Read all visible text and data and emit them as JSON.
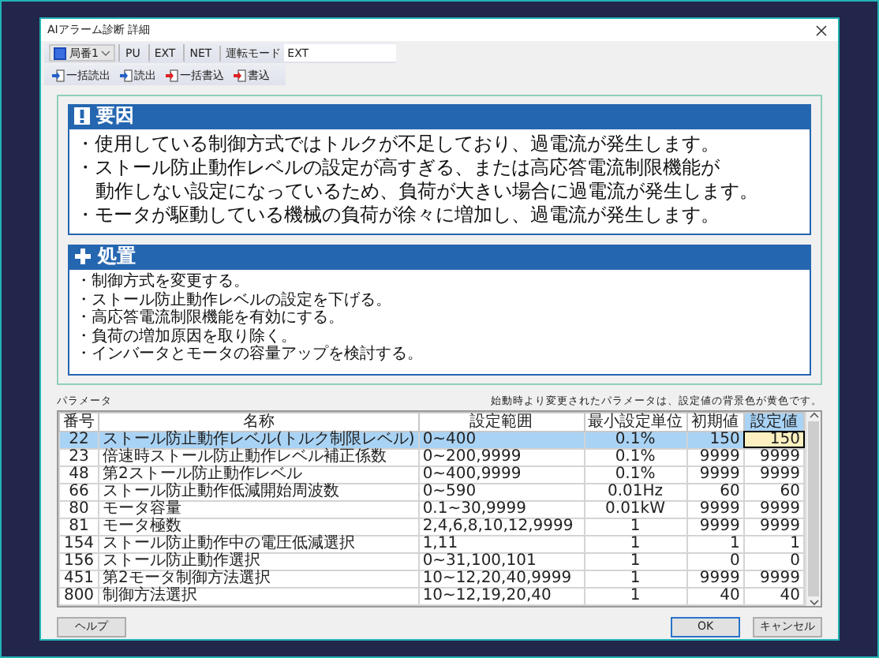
{
  "window": {
    "title": "AIアラーム診断 詳細"
  },
  "toolbar": {
    "station": "局番1",
    "modes": [
      "PU",
      "EXT",
      "NET"
    ],
    "mode_label": "運転モード",
    "mode_value": "EXT"
  },
  "actions": [
    {
      "label": "一括読出",
      "kind": "read"
    },
    {
      "label": "読出",
      "kind": "read"
    },
    {
      "label": "一括書込",
      "kind": "write"
    },
    {
      "label": "書込",
      "kind": "write"
    }
  ],
  "cause": {
    "title": "要因",
    "items": [
      {
        "text": "・使用している制御方式ではトルクが不足しており、過電流が発生します。",
        "kind": "bullet"
      },
      {
        "text": "・ストール防止動作レベルの設定が高すぎる、または高応答電流制限機能が",
        "kind": "bullet"
      },
      {
        "text": "動作しない設定になっているため、負荷が大きい場合に過電流が発生します。",
        "kind": "continuation"
      },
      {
        "text": "・モータが駆動している機械の負荷が徐々に増加し、過電流が発生します。",
        "kind": "bullet"
      }
    ]
  },
  "remedy": {
    "title": "処置",
    "items": [
      "・制御方式を変更する。",
      "・ストール防止動作レベルの設定を下げる。",
      "・高応答電流制限機能を有効にする。",
      "・負荷の増加原因を取り除く。",
      "・インバータとモータの容量アップを検討する。"
    ]
  },
  "parameters": {
    "label": "パラメータ",
    "notice": "始動時より変更されたパラメータは、設定値の背景色が黄色です。",
    "columns": [
      {
        "label": "番号",
        "selected": false
      },
      {
        "label": "名称",
        "selected": false
      },
      {
        "label": "設定範囲",
        "selected": false
      },
      {
        "label": "最小設定単位",
        "selected": false
      },
      {
        "label": "初期値",
        "selected": false
      },
      {
        "label": "設定値",
        "selected": true
      }
    ],
    "rows": [
      {
        "cells": [
          "22",
          "ストール防止動作レベル(トルク制限レベル)",
          "0~400",
          "0.1%",
          "150",
          "150"
        ],
        "selected": true
      },
      {
        "cells": [
          "23",
          "倍速時ストール防止動作レベル補正係数",
          "0~200,9999",
          "0.1%",
          "9999",
          "9999"
        ],
        "selected": false
      },
      {
        "cells": [
          "48",
          "第2ストール防止動作レベル",
          "0~400,9999",
          "0.1%",
          "9999",
          "9999"
        ],
        "selected": false
      },
      {
        "cells": [
          "66",
          "ストール防止動作低減開始周波数",
          "0~590",
          "0.01Hz",
          "60",
          "60"
        ],
        "selected": false
      },
      {
        "cells": [
          "80",
          "モータ容量",
          "0.1~30,9999",
          "0.01kW",
          "9999",
          "9999"
        ],
        "selected": false
      },
      {
        "cells": [
          "81",
          "モータ極数",
          "2,4,6,8,10,12,9999",
          "1",
          "9999",
          "9999"
        ],
        "selected": false
      },
      {
        "cells": [
          "154",
          "ストール防止動作中の電圧低減選択",
          "1,11",
          "1",
          "1",
          "1"
        ],
        "selected": false
      },
      {
        "cells": [
          "156",
          "ストール防止動作選択",
          "0~31,100,101",
          "1",
          "0",
          "0"
        ],
        "selected": false
      },
      {
        "cells": [
          "451",
          "第2モータ制御方法選択",
          "10~12,20,40,9999",
          "1",
          "9999",
          "9999"
        ],
        "selected": false
      },
      {
        "cells": [
          "800",
          "制御方法選択",
          "10~12,19,20,40",
          "1",
          "40",
          "40"
        ],
        "selected": false
      }
    ]
  },
  "buttons": [
    {
      "label": "ヘルプ",
      "kind": "help"
    },
    {
      "label": "OK",
      "kind": "ok"
    },
    {
      "label": "キャンセル",
      "kind": "cancel"
    }
  ]
}
